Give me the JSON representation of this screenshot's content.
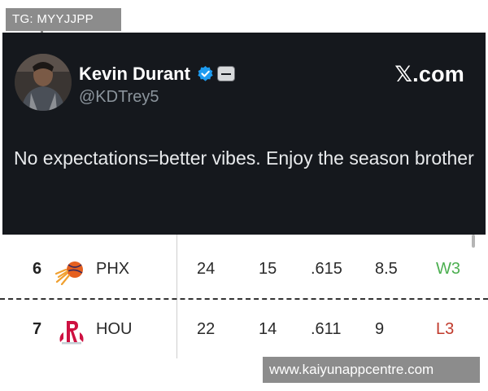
{
  "overlay": {
    "tag_text": "TG: MYYJJPP",
    "watermark_text": "www.kaiyunappcentre.com"
  },
  "tweet": {
    "display_name": "Kevin Durant",
    "handle": "@KDTrey5",
    "source_label": "𝕏.com",
    "text": "No expectations=better vibes. Enjoy the season brother",
    "avatar_icon": "avatar",
    "verified_icon": "verified-badge-icon",
    "verified_color": "#1d9bf0",
    "background": "#15181d"
  },
  "standings": {
    "rows": [
      {
        "rank": "6",
        "logo_icon": "suns-logo-icon",
        "team": "PHX",
        "wins": "24",
        "losses": "15",
        "pct": ".615",
        "gb": "8.5",
        "streak": "W3",
        "streak_color": "#4caf50"
      },
      {
        "rank": "7",
        "logo_icon": "rockets-logo-icon",
        "team": "HOU",
        "wins": "22",
        "losses": "14",
        "pct": ".611",
        "gb": "9",
        "streak": "L3",
        "streak_color": "#c0392b"
      }
    ]
  }
}
